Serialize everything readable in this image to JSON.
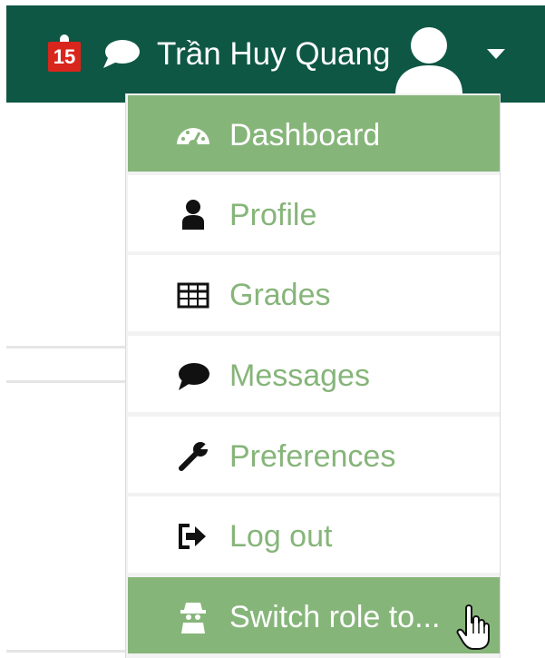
{
  "header": {
    "notification_count": "15",
    "user_name": "Trần Huy Quang",
    "colors": {
      "bar": "#0f5745",
      "badge": "#d9261c",
      "text": "#ffffff"
    }
  },
  "user_menu": {
    "items": [
      {
        "label": "Dashboard",
        "icon": "dashboard-icon",
        "active": true
      },
      {
        "label": "Profile",
        "icon": "user-icon",
        "active": false
      },
      {
        "label": "Grades",
        "icon": "table-icon",
        "active": false
      },
      {
        "label": "Messages",
        "icon": "comment-icon",
        "active": false
      },
      {
        "label": "Preferences",
        "icon": "wrench-icon",
        "active": false
      },
      {
        "label": "Log out",
        "icon": "sign-out-icon",
        "active": false
      },
      {
        "label": "Switch role to...",
        "icon": "user-secret-icon",
        "active": true
      }
    ],
    "colors": {
      "accent": "#86b57a",
      "item_bg": "#ffffff",
      "separator": "#f2f2f2"
    }
  }
}
